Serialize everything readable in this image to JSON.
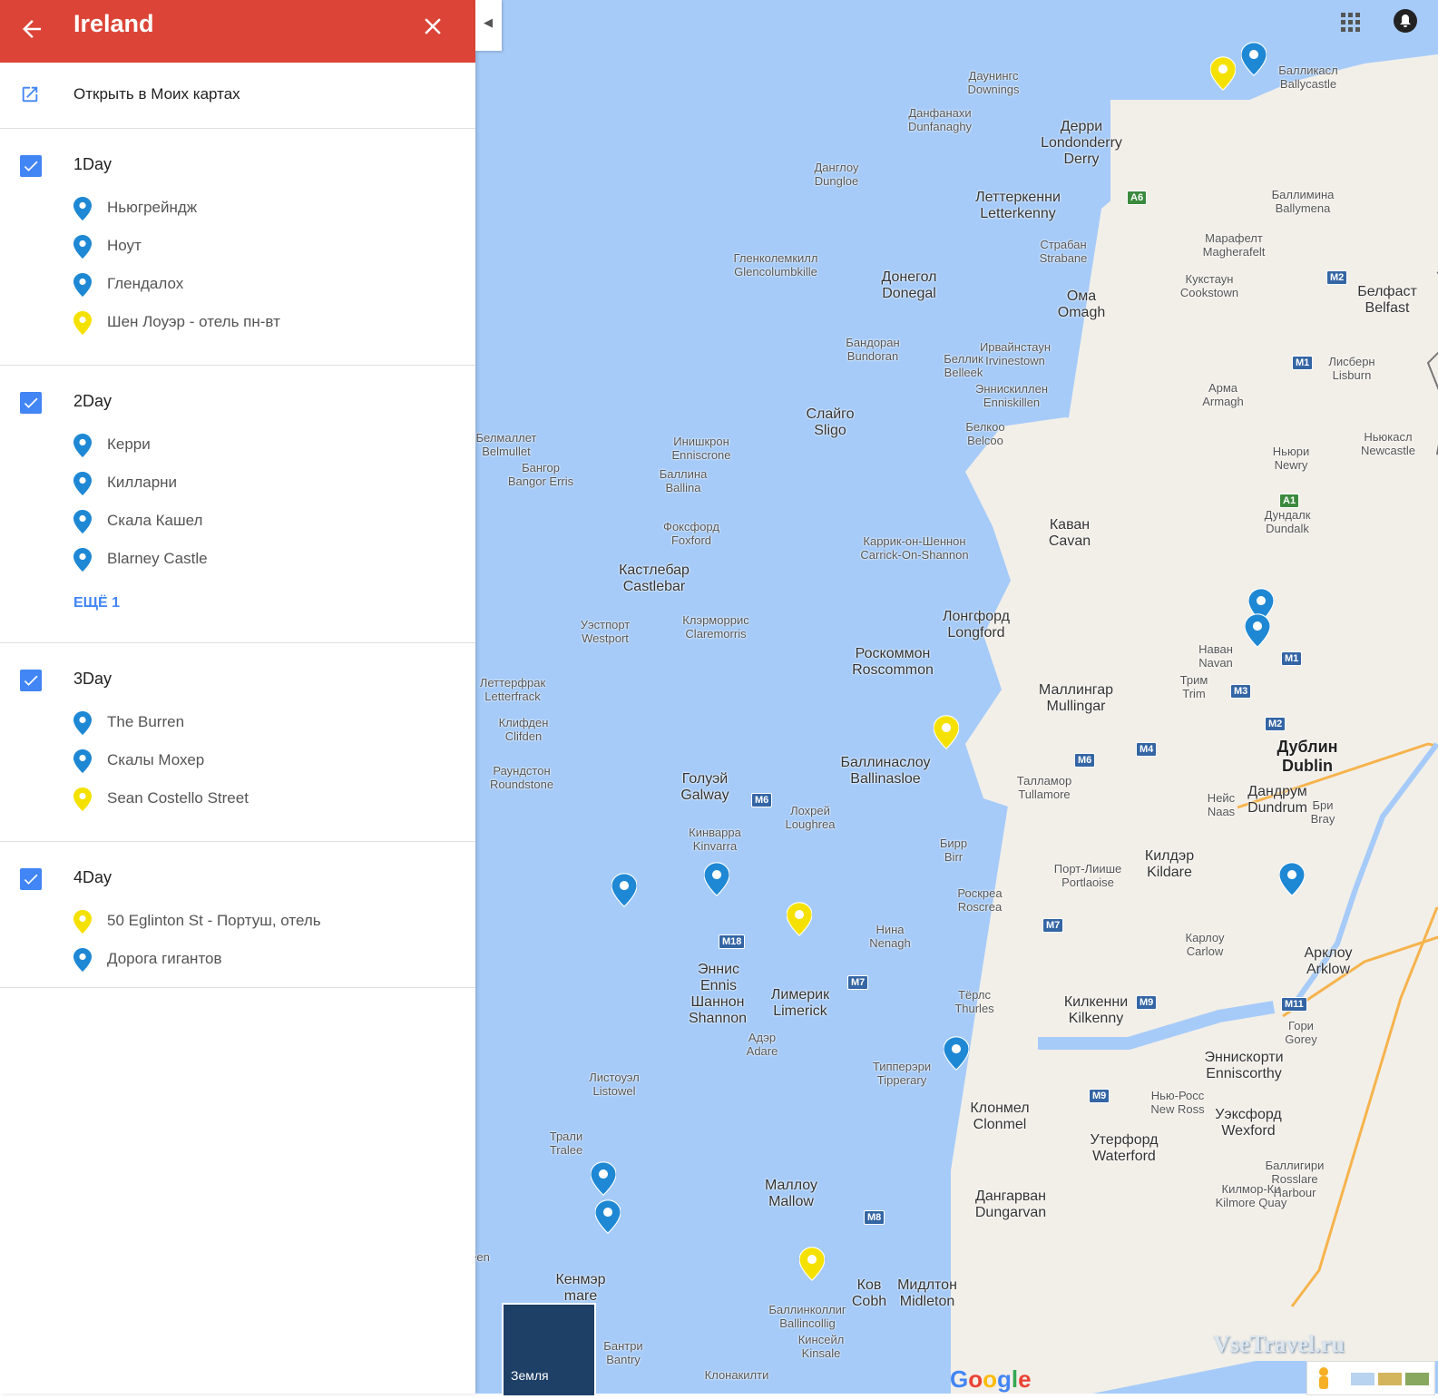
{
  "header": {
    "title": "Ireland"
  },
  "open_label": "Открыть в Моих картах",
  "layers": [
    {
      "name": "1Day",
      "places": [
        {
          "name": "Ньюгрейндж",
          "color": "#1e88d4"
        },
        {
          "name": "Ноут",
          "color": "#1e88d4"
        },
        {
          "name": "Глендалох",
          "color": "#1e88d4"
        },
        {
          "name": "Шен Лоуэр - отель пн-вт",
          "color": "#f5e100"
        }
      ]
    },
    {
      "name": "2Day",
      "places": [
        {
          "name": "Керри",
          "color": "#1e88d4"
        },
        {
          "name": "Килларни",
          "color": "#1e88d4"
        },
        {
          "name": "Скала Кашел",
          "color": "#1e88d4"
        },
        {
          "name": "Blarney Castle",
          "color": "#1e88d4"
        }
      ],
      "more": "ЕЩЁ 1"
    },
    {
      "name": "3Day",
      "places": [
        {
          "name": "The Burren",
          "color": "#1e88d4"
        },
        {
          "name": "Скалы Мохер",
          "color": "#1e88d4"
        },
        {
          "name": "Sean Costello Street",
          "color": "#f5e100"
        }
      ]
    },
    {
      "name": "4Day",
      "places": [
        {
          "name": "50 Eglinton St - Портуш, отель",
          "color": "#f5e100"
        },
        {
          "name": "Дорога гигантов",
          "color": "#1e88d4"
        }
      ]
    }
  ],
  "map": {
    "earth_label": "Земля",
    "google": "Google",
    "watermark": "VseTravel.ru",
    "cities": [
      {
        "t": "Даунингс\nDownings"
      },
      {
        "t": "Данфанахи\nDunfanaghy"
      },
      {
        "t": "Дерри\nLondonderry\nDerry"
      },
      {
        "t": "Балликасл\nBallycastle"
      },
      {
        "t": "Данглоу\nDungloe"
      },
      {
        "t": "Леттеркенни\nLetterkenny"
      },
      {
        "t": "Баллимина\nBallymena"
      },
      {
        "t": "Страбан\nStrabane"
      },
      {
        "t": "Марафелт\nMagherafelt"
      },
      {
        "t": "Гленколемкилл\nGlencolumbkille"
      },
      {
        "t": "Донегол\nDonegal"
      },
      {
        "t": "Кукстаун\nCookstown"
      },
      {
        "t": "Ома\nOmagh"
      },
      {
        "t": "Белфаст\nBelfast"
      },
      {
        "t": "Бандоран\nBundoran"
      },
      {
        "t": "Беллик\nBelleek"
      },
      {
        "t": "Ирвайнстаун\nIrvinestown"
      },
      {
        "t": "Лисберн\nLisburn"
      },
      {
        "t": "Эннискиллен\nEnniskillen"
      },
      {
        "t": "Арма\nArmagh"
      },
      {
        "t": "Слайго\nSligo"
      },
      {
        "t": "Белкоо\nBelcoo"
      },
      {
        "t": "Ньюкасл\nNewcastle"
      },
      {
        "t": "Ньюри\nNewry"
      },
      {
        "t": "Белмаллет\nBelmullet"
      },
      {
        "t": "Инишкрон\nEnniscrone"
      },
      {
        "t": "Бангор\nBangor Erris"
      },
      {
        "t": "Баллина\nBallina"
      },
      {
        "t": "Дундалк\nDundalk"
      },
      {
        "t": "Каван\nCavan"
      },
      {
        "t": "Фоксфорд\nFoxford"
      },
      {
        "t": "Каррик-он-Шеннон\nCarrick-On-Shannon"
      },
      {
        "t": "Кастлебар\nCastlebar"
      },
      {
        "t": "Клэрморрис\nClaremorris"
      },
      {
        "t": "Уэстпорт\nWestport"
      },
      {
        "t": "Лонгфорд\nLongford"
      },
      {
        "t": "Наван\nNavan"
      },
      {
        "t": "Роскоммон\nRoscommon"
      },
      {
        "t": "Трим\nTrim"
      },
      {
        "t": "Леттерфрак\nLetterfrack"
      },
      {
        "t": "Маллингар\nMullingar"
      },
      {
        "t": "Клифден\nClifden"
      },
      {
        "t": "Дублин\nDublin"
      },
      {
        "t": "Баллинаслоу\nBallinasloe"
      },
      {
        "t": "Раундстон\nRoundstone"
      },
      {
        "t": "Голуэй\nGalway"
      },
      {
        "t": "Талламор\nTullamore"
      },
      {
        "t": "Дандрум\nDundrum"
      },
      {
        "t": "Нейс\nNaas"
      },
      {
        "t": "Бри\nBray"
      },
      {
        "t": "Лохрей\nLoughrea"
      },
      {
        "t": "Кинварра\nKinvarra"
      },
      {
        "t": "Бирр\nBirr"
      },
      {
        "t": "Килдэр\nKildare"
      },
      {
        "t": "Порт-Лиише\nPortlaoise"
      },
      {
        "t": "Роскреа\nRoscrea"
      },
      {
        "t": "Нина\nNenagh"
      },
      {
        "t": "Карлоу\nCarlow"
      },
      {
        "t": "Арклоу\nArklow"
      },
      {
        "t": "Эннис\nEnnis"
      },
      {
        "t": "Лимерик\nLimerick"
      },
      {
        "t": "Шаннон\nShannon"
      },
      {
        "t": "Тёрлс\nThurles"
      },
      {
        "t": "Килкенни\nKilkenny"
      },
      {
        "t": "Гори\nGorey"
      },
      {
        "t": "Адэр\nAdare"
      },
      {
        "t": "Листоуэл\nListowel"
      },
      {
        "t": "Типперэри\nTipperary"
      },
      {
        "t": "Эннискорти\nEnniscorthy"
      },
      {
        "t": "Нью-Росс\nNew Ross"
      },
      {
        "t": "Клонмел\nClonmel"
      },
      {
        "t": "Трали\nTralee"
      },
      {
        "t": "Уэксфорд\nWexford"
      },
      {
        "t": "Утерфорд\nWaterford"
      },
      {
        "t": "Баллигири\nRosslare\nHarbour"
      },
      {
        "t": "Маллоу\nMallow"
      },
      {
        "t": "Килмор-Ки\nKilmore Quay"
      },
      {
        "t": "Дангарван\nDungarvan"
      },
      {
        "t": "Кенмэр\nmare"
      },
      {
        "t": "Ков\nCobh"
      },
      {
        "t": "Мидлтон\nMidleton"
      },
      {
        "t": "Баллинколлиг\nBallincollig"
      },
      {
        "t": "Кинсейл\nKinsale"
      },
      {
        "t": "Бантри\nBantry"
      },
      {
        "t": "Клонакилти"
      },
      {
        "t": "een"
      }
    ],
    "roads": [
      "A6",
      "M2",
      "M1",
      "A1",
      "M1",
      "M3",
      "M2",
      "M4",
      "M6",
      "M6",
      "M18",
      "M7",
      "M7",
      "M9",
      "M11",
      "M9",
      "M8"
    ]
  }
}
